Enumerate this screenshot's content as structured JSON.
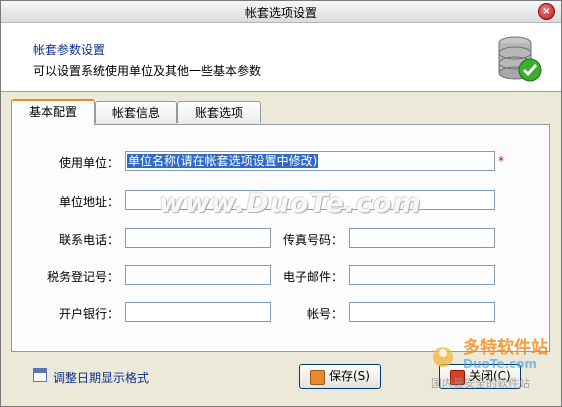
{
  "window": {
    "title": "帐套选项设置"
  },
  "header": {
    "title": "帐套参数设置",
    "subtitle": "可以设置系统使用单位及其他一些基本参数",
    "icon": "database-check-icon"
  },
  "tabs": [
    {
      "label": "基本配置",
      "active": true
    },
    {
      "label": "帐套信息",
      "active": false
    },
    {
      "label": "账套选项",
      "active": false
    }
  ],
  "form": {
    "unit_name": {
      "label": "使用单位：",
      "value": "单位名称(请在帐套选项设置中修改)",
      "required_mark": "*"
    },
    "address": {
      "label": "单位地址：",
      "value": ""
    },
    "phone": {
      "label": "联系电话：",
      "value": ""
    },
    "fax": {
      "label": "传真号码：",
      "value": ""
    },
    "tax_no": {
      "label": "税务登记号：",
      "value": ""
    },
    "email": {
      "label": "电子邮件：",
      "value": ""
    },
    "bank": {
      "label": "开户银行：",
      "value": ""
    },
    "account": {
      "label": "帐号：",
      "value": ""
    }
  },
  "watermark": "www.DuoTe.com",
  "footer": {
    "date_format_link": "调整日期显示格式",
    "save_label": "保存(S)",
    "close_label": "关闭(C)"
  },
  "logo": {
    "line1": "多特软件站",
    "line2": "DuoTe.com",
    "line3": "国内最安全的软件站"
  },
  "colors": {
    "accent": "#e68b2c",
    "header_text": "#0b2e8e",
    "required": "#d00000"
  }
}
